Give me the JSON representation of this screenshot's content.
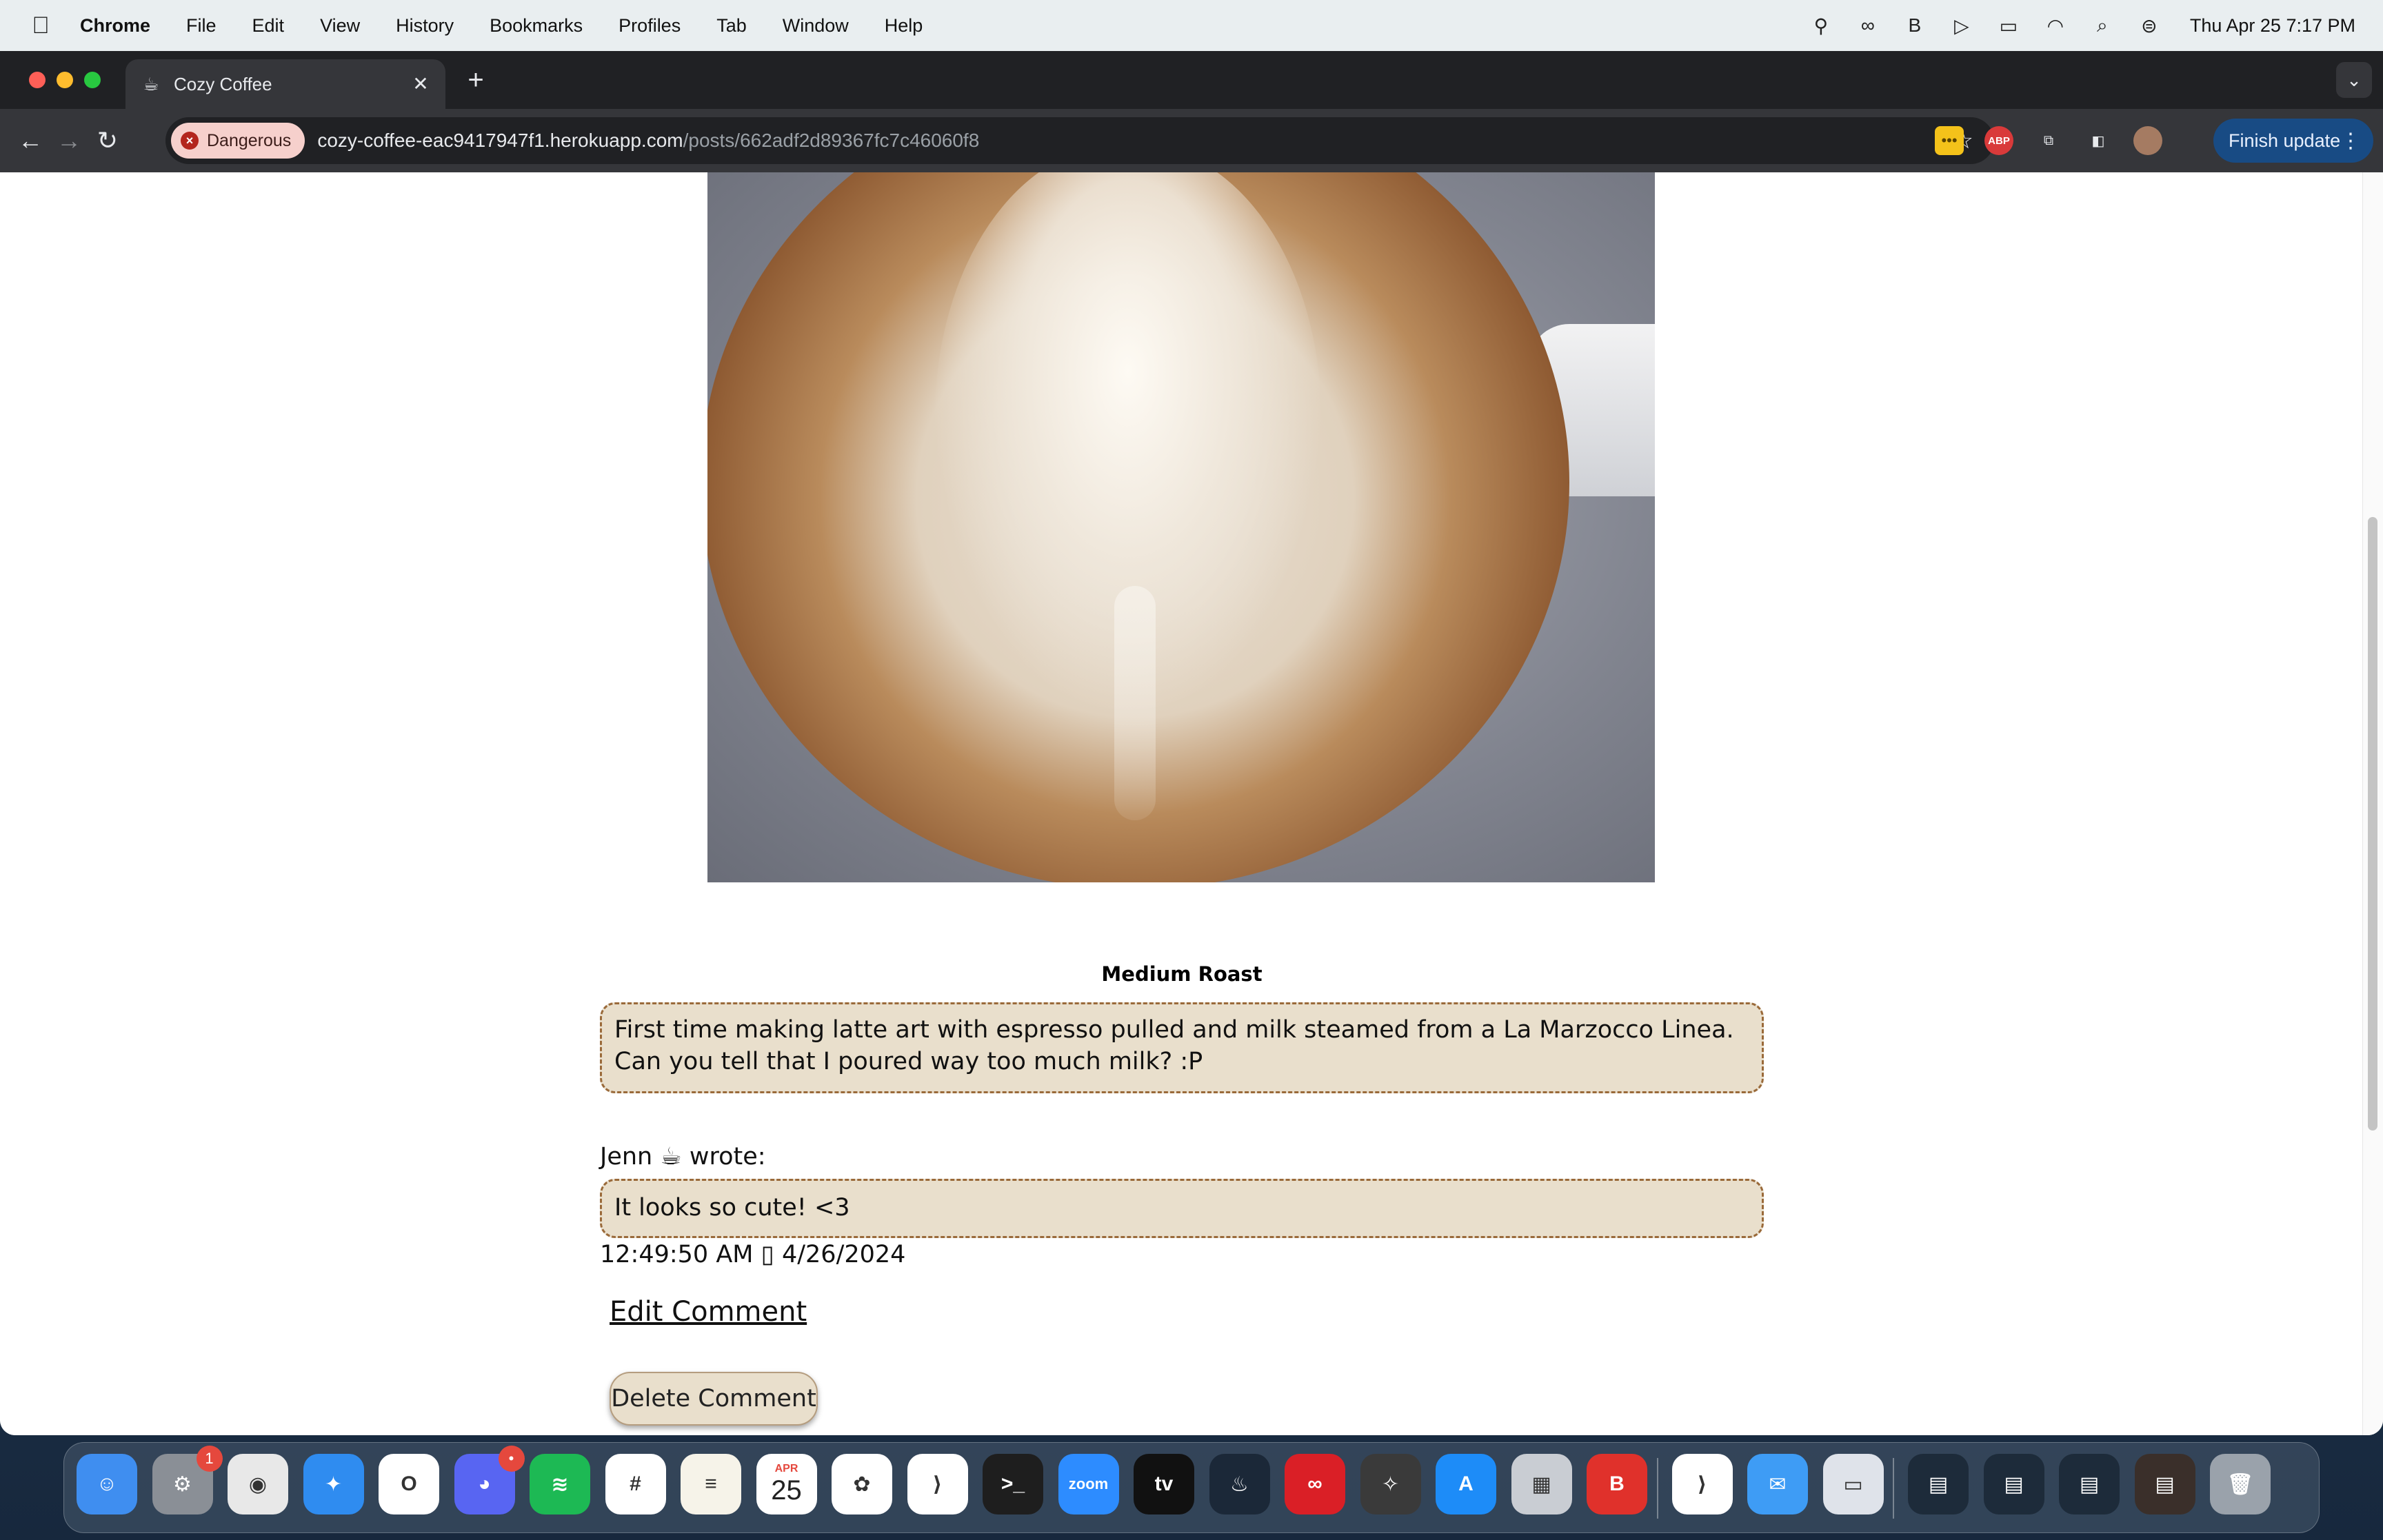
{
  "menubar": {
    "app_name": "Chrome",
    "items": [
      "File",
      "Edit",
      "View",
      "History",
      "Bookmarks",
      "Profiles",
      "Tab",
      "Window",
      "Help"
    ],
    "clock": "Thu Apr 25  7:17 PM",
    "status_icons": [
      "lock-person-icon",
      "creative-cloud-icon",
      "bold-b-icon",
      "play-icon",
      "battery-icon",
      "wifi-icon",
      "spotlight-search-icon",
      "control-center-icon"
    ]
  },
  "browser": {
    "tab_title": "Cozy Coffee",
    "tab_favicon": "coffee-cup-icon",
    "security_chip": "Dangerous",
    "url_host": "cozy-coffee-eac9417947f1.herokuapp.com",
    "url_path": "/posts/662adf2d89367fc7c46060f8",
    "finish_update_label": "Finish update",
    "extensions": [
      "yellow-extension-icon",
      "adblock-plus-icon",
      "extensions-puzzle-icon",
      "side-panel-icon",
      "profile-avatar-icon"
    ],
    "extension_abp_label": "ABP"
  },
  "post": {
    "image_alt": "latte art heart in a white cup",
    "roast": "Medium Roast",
    "caption": "First time making latte art with espresso pulled and milk steamed from a La Marzocco Linea. Can you tell that I poured way too much milk? :P"
  },
  "comment": {
    "author_line": "Jenn ☕ wrote:",
    "text": "It looks so cute! <3",
    "timestamp": "12:49:50 AM ▯ 4/26/2024",
    "edit_label": "Edit Comment",
    "delete_label": "Delete Comment"
  },
  "dock": {
    "apps": [
      {
        "name": "Finder",
        "icon": "finder-icon",
        "color": "#3f8ef0",
        "label": "☺"
      },
      {
        "name": "System Settings",
        "icon": "system-settings-icon",
        "color": "#8a8f96",
        "label": "⚙",
        "badge": "1"
      },
      {
        "name": "Chrome",
        "icon": "chrome-icon",
        "color": "#e8e8e8",
        "label": "◉"
      },
      {
        "name": "Safari",
        "icon": "safari-icon",
        "color": "#2f8cf0",
        "label": "✦"
      },
      {
        "name": "Opera",
        "icon": "opera-icon",
        "color": "#ffffff",
        "label": "O"
      },
      {
        "name": "Discord",
        "icon": "discord-icon",
        "color": "#5865f2",
        "label": "◕",
        "badge": "•"
      },
      {
        "name": "Spotify",
        "icon": "spotify-icon",
        "color": "#1db954",
        "label": "≋"
      },
      {
        "name": "Slack",
        "icon": "slack-icon",
        "color": "#ffffff",
        "label": "#"
      },
      {
        "name": "Notes",
        "icon": "notes-icon",
        "color": "#f6f3e9",
        "label": "≡"
      },
      {
        "name": "Calendar",
        "icon": "calendar-icon",
        "color": "#ffffff",
        "label": "25",
        "sublabel": "APR"
      },
      {
        "name": "Photos",
        "icon": "photos-icon",
        "color": "#ffffff",
        "label": "✿"
      },
      {
        "name": "Visual Studio Code",
        "icon": "vscode-icon",
        "color": "#ffffff",
        "label": "⟩"
      },
      {
        "name": "Terminal",
        "icon": "terminal-icon",
        "color": "#1e1e1e",
        "label": ">_"
      },
      {
        "name": "Zoom",
        "icon": "zoom-icon",
        "color": "#2d8cff",
        "label": "zoom"
      },
      {
        "name": "Apple TV",
        "icon": "apple-tv-icon",
        "color": "#111111",
        "label": "tv"
      },
      {
        "name": "Steam",
        "icon": "steam-icon",
        "color": "#1b2838",
        "label": "♨"
      },
      {
        "name": "Creative Cloud",
        "icon": "creative-cloud-icon",
        "color": "#da1f26",
        "label": "∞"
      },
      {
        "name": "Compass",
        "icon": "compass-icon",
        "color": "#3a3a3a",
        "label": "✧"
      },
      {
        "name": "App Store",
        "icon": "app-store-icon",
        "color": "#1d8cf8",
        "label": "A"
      },
      {
        "name": "Launchpad",
        "icon": "launchpad-icon",
        "color": "#c9cdd3",
        "label": "▦"
      },
      {
        "name": "Bear",
        "icon": "bold-b-app-icon",
        "color": "#e0312b",
        "label": "B"
      },
      {
        "name": "VS Code",
        "icon": "vscode-blue-icon",
        "color": "#ffffff",
        "label": "⟩"
      },
      {
        "name": "Mail",
        "icon": "mail-icon",
        "color": "#3e9cf5",
        "label": "✉"
      },
      {
        "name": "Preview",
        "icon": "preview-icon",
        "color": "#dfe3ea",
        "label": "▭"
      },
      {
        "name": "Window 1",
        "icon": "minimized-window-icon",
        "color": "#1d2b3a",
        "label": "▤"
      },
      {
        "name": "Window 2",
        "icon": "minimized-window-icon",
        "color": "#1d2b3a",
        "label": "▤"
      },
      {
        "name": "Window 3",
        "icon": "minimized-window-icon",
        "color": "#1d2b3a",
        "label": "▤"
      },
      {
        "name": "Window 4",
        "icon": "minimized-window-icon",
        "color": "#3a2f2a",
        "label": "▤"
      },
      {
        "name": "Trash",
        "icon": "trash-icon",
        "color": "#9aa2ab",
        "label": "🗑"
      }
    ]
  }
}
